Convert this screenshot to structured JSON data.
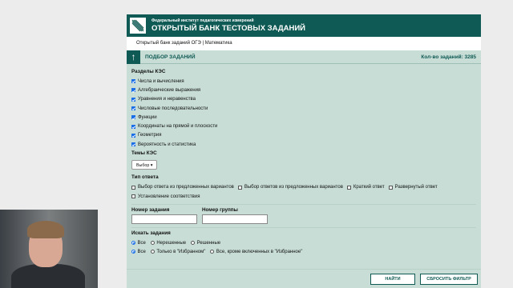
{
  "header": {
    "subtitle": "Федеральный институт педагогических измерений",
    "title": "ОТКРЫТЫЙ БАНК ТЕСТОВЫХ ЗАДАНИЙ"
  },
  "breadcrumb": "Открытый банк заданий ОГЭ | Математика",
  "panel": {
    "title": "ПОДБОР ЗАДАНИЙ",
    "count": "Кол-во заданий: 3285"
  },
  "kes": {
    "title": "Разделы КЭС",
    "items": [
      {
        "label": "Числа и вычисления",
        "checked": true
      },
      {
        "label": "Алгебраические выражения",
        "checked": true
      },
      {
        "label": "Уравнения и неравенства",
        "checked": true
      },
      {
        "label": "Числовые последовательности",
        "checked": true
      },
      {
        "label": "Функции",
        "checked": true
      },
      {
        "label": "Координаты на прямой и плоскости",
        "checked": true
      },
      {
        "label": "Геометрия",
        "checked": true
      },
      {
        "label": "Вероятность и статистика",
        "checked": true
      }
    ]
  },
  "topics": {
    "title": "Темы КЭС",
    "select": "Выбор"
  },
  "answer_type": {
    "title": "Тип ответа",
    "options": [
      "Выбор ответа из предложенных вариантов",
      "Выбор ответов из предложенных вариантов",
      "Краткий ответ",
      "Развернутый ответ",
      "Установление соответствия"
    ]
  },
  "fields": {
    "task_number": "Номер задания",
    "group_number": "Номер группы"
  },
  "search": {
    "title": "Искать задания",
    "row1": [
      {
        "label": "Все",
        "selected": true
      },
      {
        "label": "Нерешенные",
        "selected": false
      },
      {
        "label": "Решенные",
        "selected": false
      }
    ],
    "row2": [
      {
        "label": "Все",
        "selected": true
      },
      {
        "label": "Только в \"Избранном\"",
        "selected": false
      },
      {
        "label": "Все, кроме включенных в \"Избранное\"",
        "selected": false
      }
    ]
  },
  "buttons": {
    "find": "НАЙТИ",
    "reset": "СБРОСИТЬ ФИЛЬТР"
  },
  "colors": {
    "brand": "#0f5a54",
    "panel": "#c8ddd6",
    "checkbox": "#1a6ee6"
  }
}
